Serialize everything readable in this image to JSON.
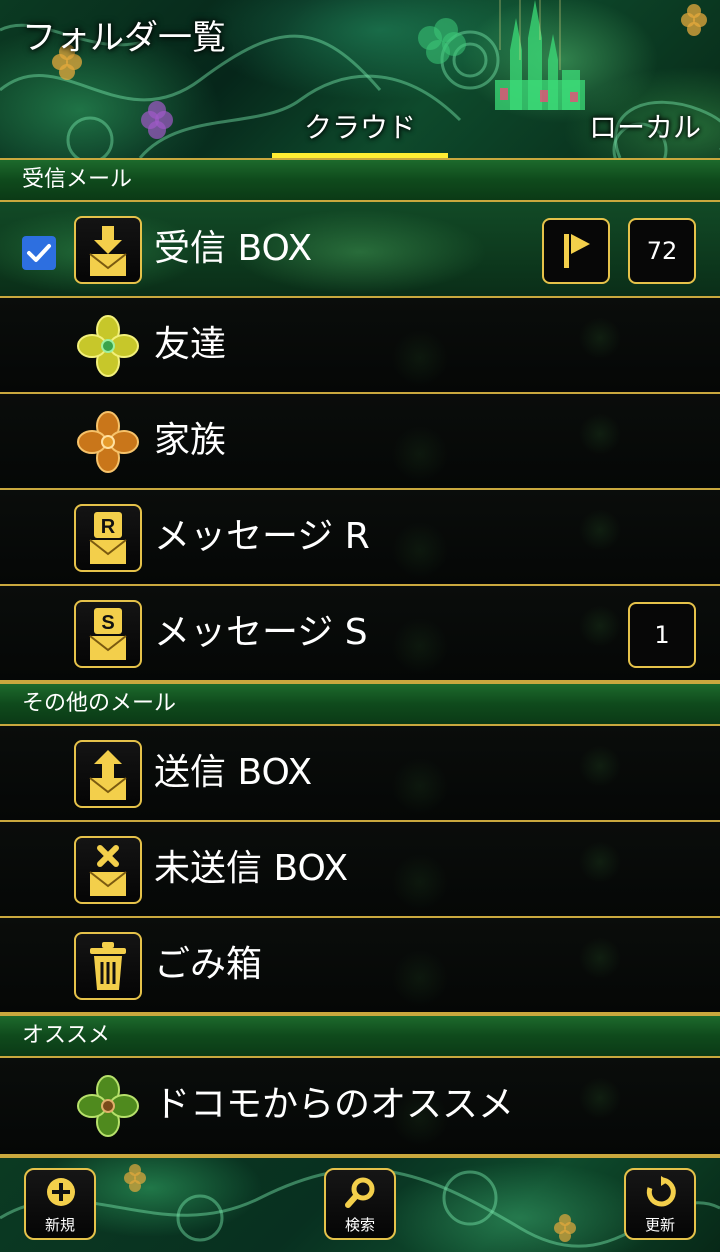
{
  "header": {
    "title": "フォルダ一覧",
    "tabs": [
      {
        "label": "クラウド",
        "active": true
      },
      {
        "label": "ローカル",
        "active": false
      }
    ]
  },
  "sections": [
    {
      "title": "受信メール",
      "items": [
        {
          "label": "受信 BOX",
          "icon": "inbox-download-icon",
          "checked": true,
          "flag": true,
          "count": "72"
        },
        {
          "label": "友達",
          "icon": "yellow-clover-icon"
        },
        {
          "label": "家族",
          "icon": "orange-clover-icon"
        },
        {
          "label": "メッセージ R",
          "icon": "message-r-icon",
          "icon_letter": "R"
        },
        {
          "label": "メッセージ S",
          "icon": "message-s-icon",
          "icon_letter": "S",
          "count": "1"
        }
      ]
    },
    {
      "title": "その他のメール",
      "items": [
        {
          "label": "送信 BOX",
          "icon": "outbox-upload-icon"
        },
        {
          "label": "未送信 BOX",
          "icon": "unsent-mail-icon"
        },
        {
          "label": "ごみ箱",
          "icon": "trash-icon"
        }
      ]
    },
    {
      "title": "オススメ",
      "items": [
        {
          "label": "ドコモからのオススメ",
          "icon": "green-clover-icon"
        }
      ]
    }
  ],
  "footer": {
    "new_label": "新規",
    "search_label": "検索",
    "refresh_label": "更新"
  },
  "colors": {
    "gold": "#e5c24a",
    "tab_underline": "#ffee33",
    "checkbox": "#2d6fe0",
    "section_green": "#1d6a2c"
  }
}
